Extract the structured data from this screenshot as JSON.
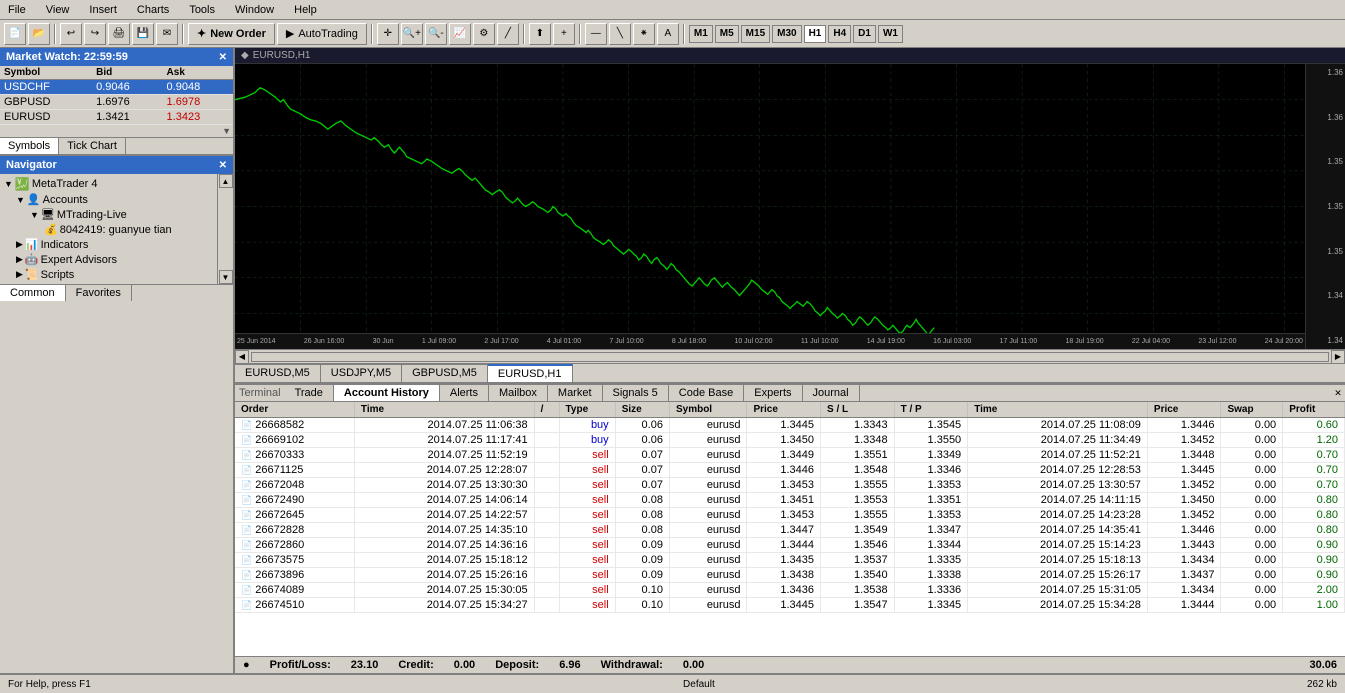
{
  "menubar": {
    "items": [
      "File",
      "View",
      "Insert",
      "Charts",
      "Tools",
      "Window",
      "Help"
    ]
  },
  "toolbar": {
    "new_order_label": "New Order",
    "autotrading_label": "AutoTrading",
    "timeframes": [
      "M1",
      "M5",
      "M15",
      "M30",
      "H1",
      "H4",
      "D1",
      "W1"
    ]
  },
  "market_watch": {
    "title": "Market Watch: 22:59:59",
    "columns": [
      "Symbol",
      "Bid",
      "Ask"
    ],
    "rows": [
      {
        "symbol": "USDCHF",
        "bid": "0.9046",
        "ask": "0.9048",
        "selected": true
      },
      {
        "symbol": "GBPUSD",
        "bid": "1.6976",
        "ask": "1.6978",
        "selected": false
      },
      {
        "symbol": "EURUSD",
        "bid": "1.3421",
        "ask": "1.3423",
        "selected": false
      }
    ],
    "tabs": [
      "Symbols",
      "Tick Chart"
    ]
  },
  "navigator": {
    "title": "Navigator",
    "tree": {
      "root": "MetaTrader 4",
      "accounts_label": "Accounts",
      "account_name": "MTrading-Live",
      "account_id": "8042419: guanyue tian",
      "indicators_label": "Indicators",
      "expert_advisors_label": "Expert Advisors",
      "scripts_label": "Scripts"
    },
    "tabs": [
      "Common",
      "Favorites"
    ]
  },
  "chart": {
    "title": "EURUSD,H1",
    "tabs": [
      "EURUSD,M5",
      "USDJPY,M5",
      "GBPUSD,M5",
      "EURUSD,H1"
    ],
    "active_tab": "EURUSD,H1",
    "y_labels": [
      "1.36",
      "1.36",
      "1.35",
      "1.35",
      "1.35",
      "1.34",
      "1.34"
    ],
    "x_labels": [
      "25 Jun 2014",
      "26 Jun 16:00",
      "30 Jun 01:00",
      "1 Jul 09:00",
      "2 Jul 17:00",
      "4 Jul 01:00",
      "7 Jul 10:00",
      "8 Jul 18:00",
      "10 Jul 02:00",
      "11 Jul 10:00",
      "14 Jul 19:00",
      "16 Jul 03:00",
      "17 Jul 11:00",
      "18 Jul 19:00",
      "22 Jul 04:00",
      "23 Jul 12:00",
      "24 Jul 20:00"
    ]
  },
  "bottom_panel": {
    "tabs": [
      "Trade",
      "Account History",
      "Alerts",
      "Mailbox",
      "Market",
      "Signals 5",
      "Code Base",
      "Experts",
      "Journal"
    ],
    "active_tab": "Account History",
    "table": {
      "columns": [
        "Order",
        "Time",
        "/",
        "Type",
        "Size",
        "Symbol",
        "Price",
        "S / L",
        "T / P",
        "Time",
        "Price",
        "Swap",
        "Profit"
      ],
      "rows": [
        {
          "order": "26668582",
          "open_time": "2014.07.25 11:06:38",
          "type": "buy",
          "size": "0.06",
          "symbol": "eurusd",
          "price": "1.3445",
          "sl": "1.3343",
          "tp": "1.3545",
          "close_time": "2014.07.25 11:08:09",
          "close_price": "1.3446",
          "swap": "0.00",
          "profit": "0.60"
        },
        {
          "order": "26669102",
          "open_time": "2014.07.25 11:17:41",
          "type": "buy",
          "size": "0.06",
          "symbol": "eurusd",
          "price": "1.3450",
          "sl": "1.3348",
          "tp": "1.3550",
          "close_time": "2014.07.25 11:34:49",
          "close_price": "1.3452",
          "swap": "0.00",
          "profit": "1.20"
        },
        {
          "order": "26670333",
          "open_time": "2014.07.25 11:52:19",
          "type": "sell",
          "size": "0.07",
          "symbol": "eurusd",
          "price": "1.3449",
          "sl": "1.3551",
          "tp": "1.3349",
          "close_time": "2014.07.25 11:52:21",
          "close_price": "1.3448",
          "swap": "0.00",
          "profit": "0.70"
        },
        {
          "order": "26671125",
          "open_time": "2014.07.25 12:28:07",
          "type": "sell",
          "size": "0.07",
          "symbol": "eurusd",
          "price": "1.3446",
          "sl": "1.3548",
          "tp": "1.3346",
          "close_time": "2014.07.25 12:28:53",
          "close_price": "1.3445",
          "swap": "0.00",
          "profit": "0.70"
        },
        {
          "order": "26672048",
          "open_time": "2014.07.25 13:30:30",
          "type": "sell",
          "size": "0.07",
          "symbol": "eurusd",
          "price": "1.3453",
          "sl": "1.3555",
          "tp": "1.3353",
          "close_time": "2014.07.25 13:30:57",
          "close_price": "1.3452",
          "swap": "0.00",
          "profit": "0.70"
        },
        {
          "order": "26672490",
          "open_time": "2014.07.25 14:06:14",
          "type": "sell",
          "size": "0.08",
          "symbol": "eurusd",
          "price": "1.3451",
          "sl": "1.3553",
          "tp": "1.3351",
          "close_time": "2014.07.25 14:11:15",
          "close_price": "1.3450",
          "swap": "0.00",
          "profit": "0.80"
        },
        {
          "order": "26672645",
          "open_time": "2014.07.25 14:22:57",
          "type": "sell",
          "size": "0.08",
          "symbol": "eurusd",
          "price": "1.3453",
          "sl": "1.3555",
          "tp": "1.3353",
          "close_time": "2014.07.25 14:23:28",
          "close_price": "1.3452",
          "swap": "0.00",
          "profit": "0.80"
        },
        {
          "order": "26672828",
          "open_time": "2014.07.25 14:35:10",
          "type": "sell",
          "size": "0.08",
          "symbol": "eurusd",
          "price": "1.3447",
          "sl": "1.3549",
          "tp": "1.3347",
          "close_time": "2014.07.25 14:35:41",
          "close_price": "1.3446",
          "swap": "0.00",
          "profit": "0.80"
        },
        {
          "order": "26672860",
          "open_time": "2014.07.25 14:36:16",
          "type": "sell",
          "size": "0.09",
          "symbol": "eurusd",
          "price": "1.3444",
          "sl": "1.3546",
          "tp": "1.3344",
          "close_time": "2014.07.25 15:14:23",
          "close_price": "1.3443",
          "swap": "0.00",
          "profit": "0.90"
        },
        {
          "order": "26673575",
          "open_time": "2014.07.25 15:18:12",
          "type": "sell",
          "size": "0.09",
          "symbol": "eurusd",
          "price": "1.3435",
          "sl": "1.3537",
          "tp": "1.3335",
          "close_time": "2014.07.25 15:18:13",
          "close_price": "1.3434",
          "swap": "0.00",
          "profit": "0.90"
        },
        {
          "order": "26673896",
          "open_time": "2014.07.25 15:26:16",
          "type": "sell",
          "size": "0.09",
          "symbol": "eurusd",
          "price": "1.3438",
          "sl": "1.3540",
          "tp": "1.3338",
          "close_time": "2014.07.25 15:26:17",
          "close_price": "1.3437",
          "swap": "0.00",
          "profit": "0.90"
        },
        {
          "order": "26674089",
          "open_time": "2014.07.25 15:30:05",
          "type": "sell",
          "size": "0.10",
          "symbol": "eurusd",
          "price": "1.3436",
          "sl": "1.3538",
          "tp": "1.3336",
          "close_time": "2014.07.25 15:31:05",
          "close_price": "1.3434",
          "swap": "0.00",
          "profit": "2.00"
        },
        {
          "order": "26674510",
          "open_time": "2014.07.25 15:34:27",
          "type": "sell",
          "size": "0.10",
          "symbol": "eurusd",
          "price": "1.3445",
          "sl": "1.3547",
          "tp": "1.3345",
          "close_time": "2014.07.25 15:34:28",
          "close_price": "1.3444",
          "swap": "0.00",
          "profit": "1.00"
        }
      ],
      "footer": {
        "profit_loss_label": "Profit/Loss:",
        "profit_loss_value": "23.10",
        "credit_label": "Credit:",
        "credit_value": "0.00",
        "deposit_label": "Deposit:",
        "deposit_value": "6.96",
        "withdrawal_label": "Withdrawal:",
        "withdrawal_value": "0.00",
        "total": "30.06"
      }
    }
  },
  "status_bar": {
    "left": "For Help, press F1",
    "middle": "Default",
    "right": "262 kb"
  }
}
